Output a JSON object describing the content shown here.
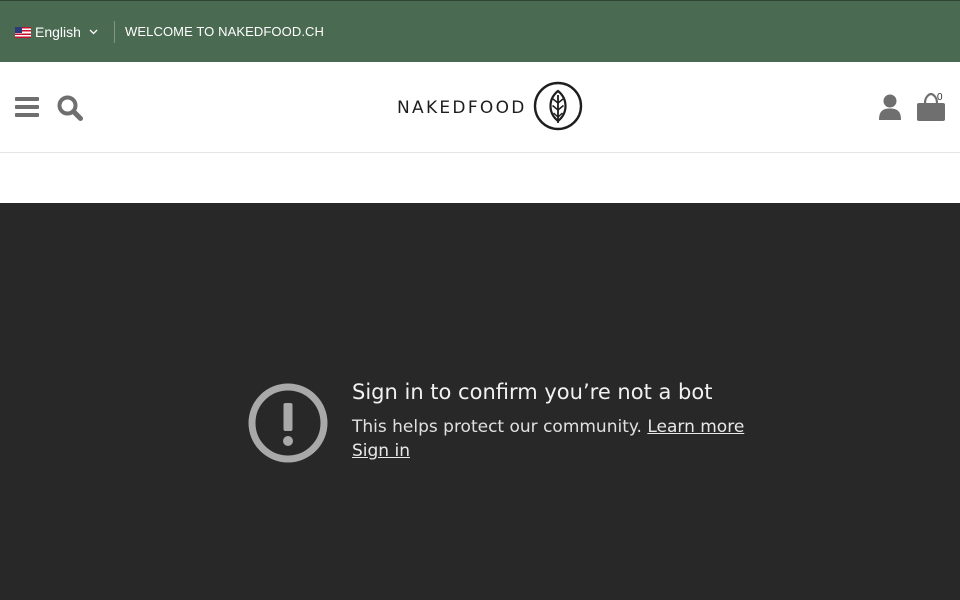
{
  "topbar": {
    "language": "English",
    "language_flag": "us-flag-icon",
    "welcome": "WELCOME TO NAKEDFOOD.CH",
    "background": "#4b6a52"
  },
  "header": {
    "logo_text": "NAKEDFOOD",
    "logo_icon": "leaf-icon",
    "cart_count": "0"
  },
  "embed": {
    "background": "#282828",
    "title": "Sign in to confirm you’re not a bot",
    "body": "This helps protect our community.",
    "learn_more": "Learn more",
    "sign_in": "Sign in",
    "icon": "alert-icon"
  }
}
